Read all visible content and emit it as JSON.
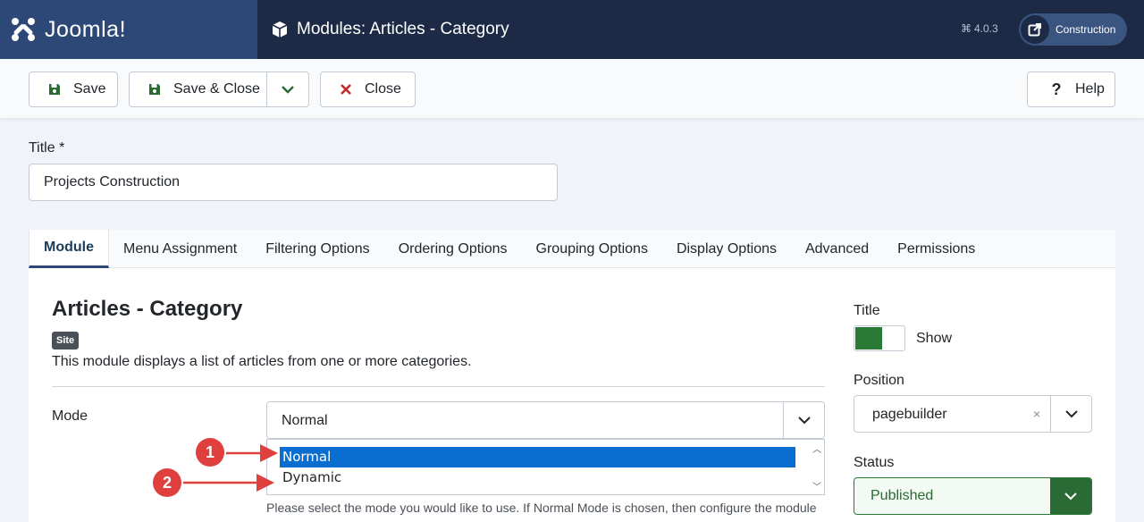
{
  "header": {
    "brand": "Joomla!",
    "page_title": "Modules: Articles - Category",
    "version": "4.0.3",
    "site_button": "Construction"
  },
  "toolbar": {
    "save": "Save",
    "save_close": "Save & Close",
    "close": "Close",
    "help": "Help"
  },
  "form": {
    "title_label": "Title *",
    "title_value": "Projects Construction"
  },
  "tabs": [
    "Module",
    "Menu Assignment",
    "Filtering Options",
    "Ordering Options",
    "Grouping Options",
    "Display Options",
    "Advanced",
    "Permissions"
  ],
  "module": {
    "heading": "Articles - Category",
    "badge": "Site",
    "description": "This module displays a list of articles from one or more categories.",
    "mode_label": "Mode",
    "mode_value": "Normal",
    "mode_options": [
      "Normal",
      "Dynamic"
    ],
    "help_text": "Please select the mode you would like to use. If Normal Mode is chosen, then configure the module"
  },
  "callouts": [
    "1",
    "2"
  ],
  "sidebar": {
    "title_label": "Title",
    "title_toggle": "Show",
    "position_label": "Position",
    "position_value": "pagebuilder",
    "position_clear": "×",
    "status_label": "Status",
    "status_value": "Published"
  },
  "colors": {
    "header_bg": "#1c2a46",
    "brand_bg": "#2d4876",
    "selected_option": "#0a6ed1",
    "callout": "#e0403d",
    "published": "#2a6a35"
  }
}
